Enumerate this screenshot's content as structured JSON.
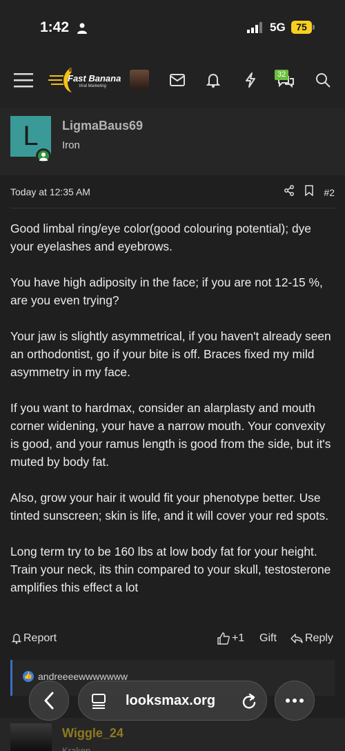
{
  "status_bar": {
    "time": "1:42",
    "network": "5G",
    "battery": "75"
  },
  "nav": {
    "logo_text": "Fast Banana",
    "logo_subtext": "Viral Marketing",
    "conversations_badge": "32",
    "icons": [
      "menu-icon",
      "mail-icon",
      "bell-icon",
      "bolt-icon",
      "chat-icon",
      "search-icon"
    ]
  },
  "post": {
    "avatar_letter": "L",
    "username": "LigmaBaus69",
    "rank": "Iron",
    "timestamp": "Today at 12:35 AM",
    "post_number": "#2",
    "paragraphs": [
      "Good limbal ring/eye color(good colouring potential); dye your eyelashes and eyebrows.",
      "You have high adiposity in the face; if you are not 12-15 %, are you even trying?",
      "Your jaw is slightly asymmetrical, if you haven't already seen an orthodontist, go if your bite is off. Braces fixed my mild asymmetry in my face.",
      "If you want to hardmax, consider an alarplasty and mouth corner widening, your have a narrow mouth. Your convexity is good, and your ramus length is good from the side, but it's muted by body fat.",
      "Also, grow your hair it would fit your phenotype better. Use tinted sunscreen; skin is life, and it will cover your red spots.",
      "Long term try to be 160 lbs at low body fat for your height. Train your neck, its thin compared to your skull, testosterone amplifies this effect a lot"
    ],
    "actions": {
      "report": "Report",
      "like": "+1",
      "gift": "Gift",
      "reply": "Reply"
    },
    "reactions_user": "andreeeewwwwwww"
  },
  "next_post": {
    "username": "Wiggle_24",
    "rank": "Kraken"
  },
  "browser": {
    "url": "looksmax.org"
  }
}
